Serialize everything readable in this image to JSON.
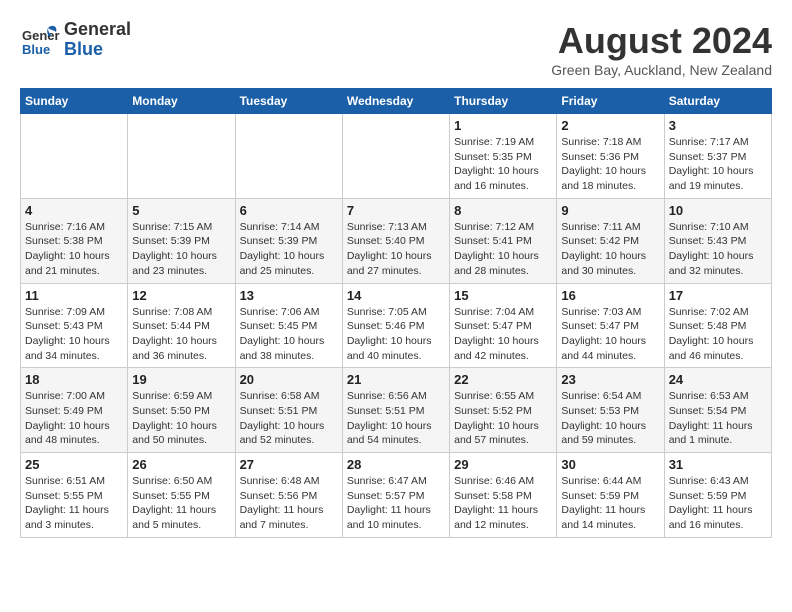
{
  "header": {
    "logo_general": "General",
    "logo_blue": "Blue",
    "month_title": "August 2024",
    "location": "Green Bay, Auckland, New Zealand"
  },
  "weekdays": [
    "Sunday",
    "Monday",
    "Tuesday",
    "Wednesday",
    "Thursday",
    "Friday",
    "Saturday"
  ],
  "weeks": [
    [
      {
        "day": "",
        "info": ""
      },
      {
        "day": "",
        "info": ""
      },
      {
        "day": "",
        "info": ""
      },
      {
        "day": "",
        "info": ""
      },
      {
        "day": "1",
        "info": "Sunrise: 7:19 AM\nSunset: 5:35 PM\nDaylight: 10 hours\nand 16 minutes."
      },
      {
        "day": "2",
        "info": "Sunrise: 7:18 AM\nSunset: 5:36 PM\nDaylight: 10 hours\nand 18 minutes."
      },
      {
        "day": "3",
        "info": "Sunrise: 7:17 AM\nSunset: 5:37 PM\nDaylight: 10 hours\nand 19 minutes."
      }
    ],
    [
      {
        "day": "4",
        "info": "Sunrise: 7:16 AM\nSunset: 5:38 PM\nDaylight: 10 hours\nand 21 minutes."
      },
      {
        "day": "5",
        "info": "Sunrise: 7:15 AM\nSunset: 5:39 PM\nDaylight: 10 hours\nand 23 minutes."
      },
      {
        "day": "6",
        "info": "Sunrise: 7:14 AM\nSunset: 5:39 PM\nDaylight: 10 hours\nand 25 minutes."
      },
      {
        "day": "7",
        "info": "Sunrise: 7:13 AM\nSunset: 5:40 PM\nDaylight: 10 hours\nand 27 minutes."
      },
      {
        "day": "8",
        "info": "Sunrise: 7:12 AM\nSunset: 5:41 PM\nDaylight: 10 hours\nand 28 minutes."
      },
      {
        "day": "9",
        "info": "Sunrise: 7:11 AM\nSunset: 5:42 PM\nDaylight: 10 hours\nand 30 minutes."
      },
      {
        "day": "10",
        "info": "Sunrise: 7:10 AM\nSunset: 5:43 PM\nDaylight: 10 hours\nand 32 minutes."
      }
    ],
    [
      {
        "day": "11",
        "info": "Sunrise: 7:09 AM\nSunset: 5:43 PM\nDaylight: 10 hours\nand 34 minutes."
      },
      {
        "day": "12",
        "info": "Sunrise: 7:08 AM\nSunset: 5:44 PM\nDaylight: 10 hours\nand 36 minutes."
      },
      {
        "day": "13",
        "info": "Sunrise: 7:06 AM\nSunset: 5:45 PM\nDaylight: 10 hours\nand 38 minutes."
      },
      {
        "day": "14",
        "info": "Sunrise: 7:05 AM\nSunset: 5:46 PM\nDaylight: 10 hours\nand 40 minutes."
      },
      {
        "day": "15",
        "info": "Sunrise: 7:04 AM\nSunset: 5:47 PM\nDaylight: 10 hours\nand 42 minutes."
      },
      {
        "day": "16",
        "info": "Sunrise: 7:03 AM\nSunset: 5:47 PM\nDaylight: 10 hours\nand 44 minutes."
      },
      {
        "day": "17",
        "info": "Sunrise: 7:02 AM\nSunset: 5:48 PM\nDaylight: 10 hours\nand 46 minutes."
      }
    ],
    [
      {
        "day": "18",
        "info": "Sunrise: 7:00 AM\nSunset: 5:49 PM\nDaylight: 10 hours\nand 48 minutes."
      },
      {
        "day": "19",
        "info": "Sunrise: 6:59 AM\nSunset: 5:50 PM\nDaylight: 10 hours\nand 50 minutes."
      },
      {
        "day": "20",
        "info": "Sunrise: 6:58 AM\nSunset: 5:51 PM\nDaylight: 10 hours\nand 52 minutes."
      },
      {
        "day": "21",
        "info": "Sunrise: 6:56 AM\nSunset: 5:51 PM\nDaylight: 10 hours\nand 54 minutes."
      },
      {
        "day": "22",
        "info": "Sunrise: 6:55 AM\nSunset: 5:52 PM\nDaylight: 10 hours\nand 57 minutes."
      },
      {
        "day": "23",
        "info": "Sunrise: 6:54 AM\nSunset: 5:53 PM\nDaylight: 10 hours\nand 59 minutes."
      },
      {
        "day": "24",
        "info": "Sunrise: 6:53 AM\nSunset: 5:54 PM\nDaylight: 11 hours\nand 1 minute."
      }
    ],
    [
      {
        "day": "25",
        "info": "Sunrise: 6:51 AM\nSunset: 5:55 PM\nDaylight: 11 hours\nand 3 minutes."
      },
      {
        "day": "26",
        "info": "Sunrise: 6:50 AM\nSunset: 5:55 PM\nDaylight: 11 hours\nand 5 minutes."
      },
      {
        "day": "27",
        "info": "Sunrise: 6:48 AM\nSunset: 5:56 PM\nDaylight: 11 hours\nand 7 minutes."
      },
      {
        "day": "28",
        "info": "Sunrise: 6:47 AM\nSunset: 5:57 PM\nDaylight: 11 hours\nand 10 minutes."
      },
      {
        "day": "29",
        "info": "Sunrise: 6:46 AM\nSunset: 5:58 PM\nDaylight: 11 hours\nand 12 minutes."
      },
      {
        "day": "30",
        "info": "Sunrise: 6:44 AM\nSunset: 5:59 PM\nDaylight: 11 hours\nand 14 minutes."
      },
      {
        "day": "31",
        "info": "Sunrise: 6:43 AM\nSunset: 5:59 PM\nDaylight: 11 hours\nand 16 minutes."
      }
    ]
  ]
}
